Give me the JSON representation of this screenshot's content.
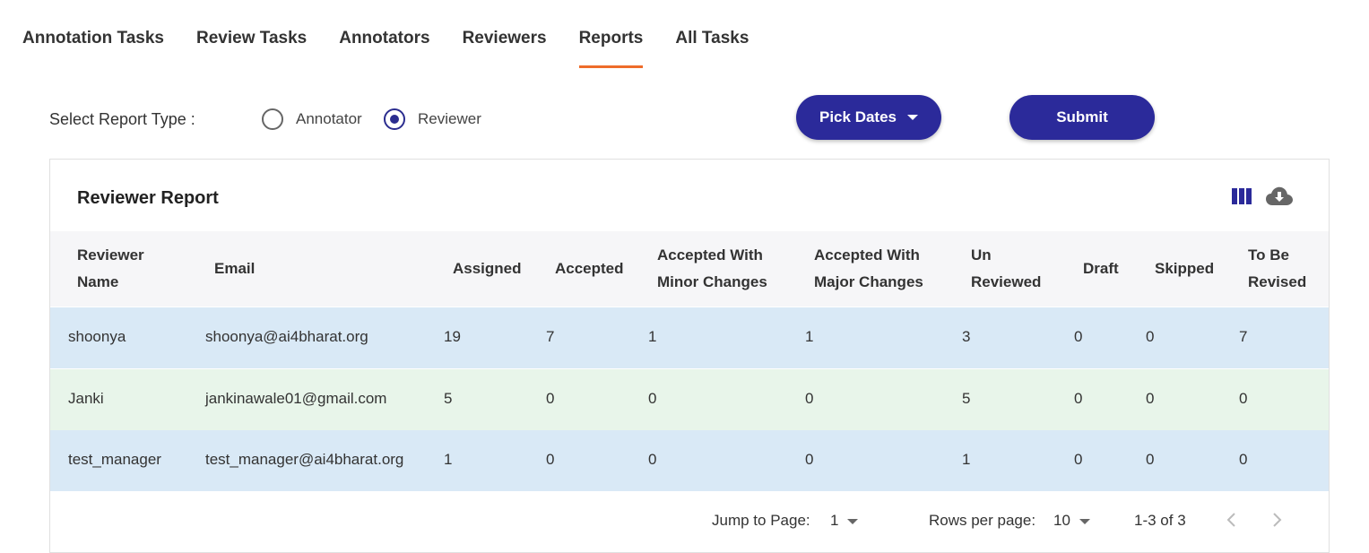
{
  "tabs": [
    {
      "label": "Annotation Tasks"
    },
    {
      "label": "Review Tasks"
    },
    {
      "label": "Annotators"
    },
    {
      "label": "Reviewers"
    },
    {
      "label": "Reports"
    },
    {
      "label": "All Tasks"
    }
  ],
  "active_tab": "Reports",
  "report_type": {
    "label": "Select Report Type :",
    "options": [
      {
        "label": "Annotator",
        "checked": false
      },
      {
        "label": "Reviewer",
        "checked": true
      }
    ]
  },
  "buttons": {
    "pick_dates": "Pick Dates",
    "submit": "Submit"
  },
  "card": {
    "title": "Reviewer Report",
    "icons": [
      "view-columns-icon",
      "cloud-download-icon"
    ]
  },
  "table": {
    "headers": [
      {
        "line1": "Reviewer",
        "line2": "Name"
      },
      {
        "line1": "Email",
        "line2": ""
      },
      {
        "line1": "Assigned",
        "line2": ""
      },
      {
        "line1": "Accepted",
        "line2": ""
      },
      {
        "line1": "Accepted With",
        "line2": "Minor Changes"
      },
      {
        "line1": "Accepted With",
        "line2": "Major Changes"
      },
      {
        "line1": "Un",
        "line2": "Reviewed"
      },
      {
        "line1": "Draft",
        "line2": ""
      },
      {
        "line1": "Skipped",
        "line2": ""
      },
      {
        "line1": "To Be",
        "line2": "Revised"
      }
    ],
    "rows": [
      [
        "shoonya",
        "shoonya@ai4bharat.org",
        "19",
        "7",
        "1",
        "1",
        "3",
        "0",
        "0",
        "7"
      ],
      [
        "Janki",
        "jankinawale01@gmail.com",
        "5",
        "0",
        "0",
        "0",
        "5",
        "0",
        "0",
        "0"
      ],
      [
        "test_manager",
        "test_manager@ai4bharat.org",
        "1",
        "0",
        "0",
        "0",
        "1",
        "0",
        "0",
        "0"
      ]
    ],
    "row_colors": [
      "#d9e9f6",
      "#e8f5ea",
      "#d9e9f6"
    ]
  },
  "pagination": {
    "jump_label": "Jump to Page:",
    "page": "1",
    "rows_label": "Rows per page:",
    "rows_per_page": "10",
    "range": "1-3 of 3"
  },
  "colors": {
    "accent": "#2b2a9a",
    "tab_underline": "#ee6c2a"
  }
}
